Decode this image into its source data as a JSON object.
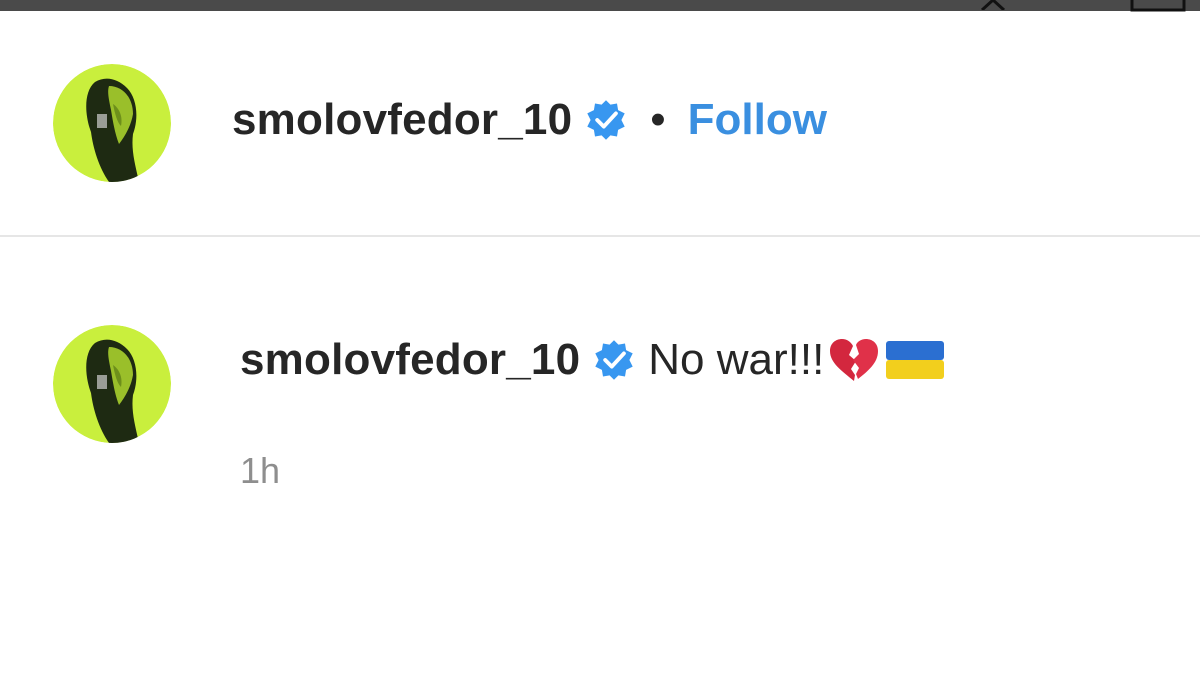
{
  "post_header": {
    "username": "smolovfedor_10",
    "verified_icon": "verified-badge-icon",
    "separator": "•",
    "follow_label": "Follow"
  },
  "comment": {
    "username": "smolovfedor_10",
    "verified_icon": "verified-badge-icon",
    "text": "No war!!!",
    "emojis": [
      "broken-heart-emoji",
      "ukraine-flag-emoji"
    ],
    "timestamp": "1h"
  },
  "colors": {
    "follow_blue": "#3a8fe0",
    "verified_blue": "#3897f0",
    "avatar_bg": "#c9ef3d",
    "timestamp_gray": "#8e8e8e"
  }
}
